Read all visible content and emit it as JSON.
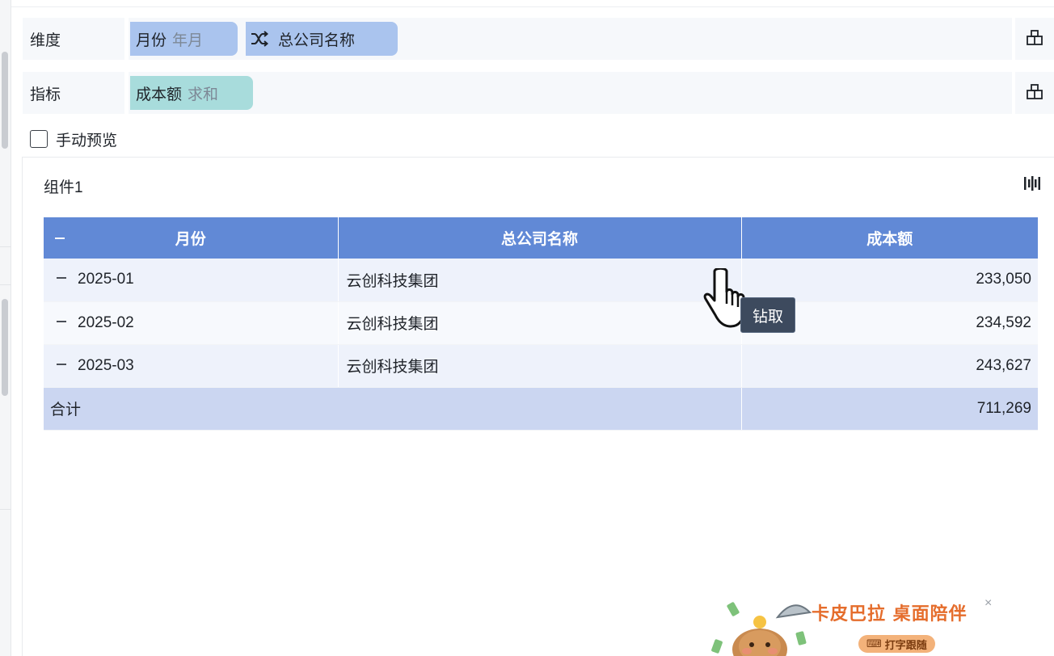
{
  "fields": {
    "dimension_label": "维度",
    "dimension_chips": [
      {
        "name": "月份",
        "sub": "年月"
      },
      {
        "name": "总公司名称",
        "sub": ""
      }
    ],
    "measure_label": "指标",
    "measure_chips": [
      {
        "name": "成本额",
        "sub": "求和"
      }
    ]
  },
  "preview": {
    "label": "手动预览",
    "checked": false
  },
  "component": {
    "title": "组件1",
    "table": {
      "headers": [
        "月份",
        "总公司名称",
        "成本额"
      ],
      "rows": [
        {
          "month": "2025-01",
          "company": "云创科技集团",
          "cost": "233,050"
        },
        {
          "month": "2025-02",
          "company": "云创科技集团",
          "cost": "234,592"
        },
        {
          "month": "2025-03",
          "company": "云创科技集团",
          "cost": "243,627"
        }
      ],
      "total_label": "合计",
      "total_value": "711,269"
    }
  },
  "tooltip": {
    "text": "钻取"
  },
  "mascot": {
    "title": "卡皮巴拉 桌面陪伴",
    "badge": "打字跟随",
    "close": "×"
  },
  "colors": {
    "header_bg": "#6189d6",
    "dim_chip": "#aac4ee",
    "measure_chip": "#a8dcdc",
    "total_row": "#cbd6f1",
    "tooltip_bg": "#3d4a5e"
  },
  "icons": [
    "shuffle-icon",
    "layout-icon",
    "chart-toggle-icon",
    "pointer-hand-icon",
    "checkbox-icon"
  ]
}
